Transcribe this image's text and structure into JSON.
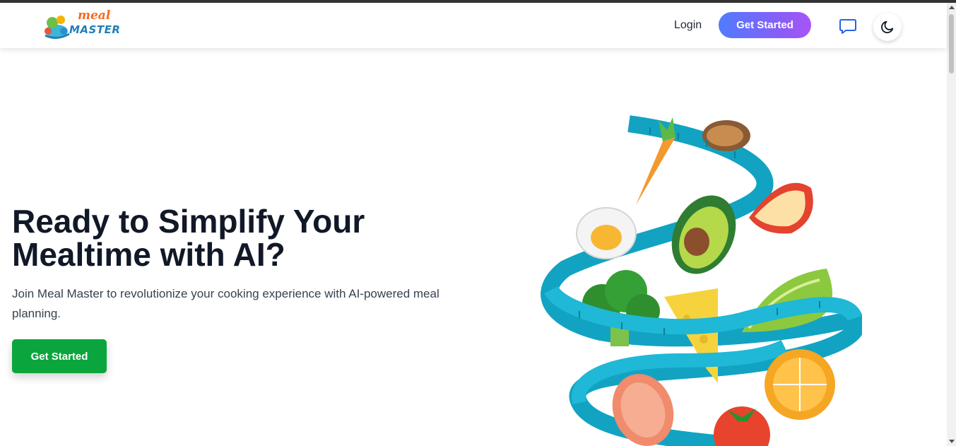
{
  "brand": {
    "logo_word_1": "meal",
    "logo_word_2": "MASTER"
  },
  "nav": {
    "login_label": "Login",
    "cta_label": "Get Started",
    "chat_icon": "chat-bubble-icon",
    "theme_icon": "moon-icon"
  },
  "hero": {
    "title": "Ready to Simplify Your Mealtime with AI?",
    "subtitle": "Join Meal Master to revolutionize your cooking experience with AI-powered meal planning.",
    "cta_label": "Get Started"
  },
  "colors": {
    "nav_cta_gradient_start": "#4f7cff",
    "nav_cta_gradient_end": "#a855f7",
    "hero_cta": "#0aa53d",
    "heading": "#111827",
    "tape": "#1fb8d6"
  }
}
